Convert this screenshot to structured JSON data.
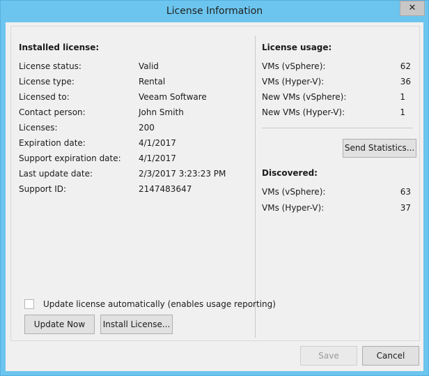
{
  "window": {
    "title": "License Information",
    "close_glyph": "✕"
  },
  "installed": {
    "heading": "Installed license:",
    "rows": [
      {
        "label": "License status:",
        "value": "Valid"
      },
      {
        "label": "License type:",
        "value": "Rental"
      },
      {
        "label": "Licensed to:",
        "value": "Veeam Software"
      },
      {
        "label": "Contact person:",
        "value": "John Smith"
      },
      {
        "label": "Licenses:",
        "value": "200"
      },
      {
        "label": "Expiration date:",
        "value": "4/1/2017"
      },
      {
        "label": "Support expiration date:",
        "value": "4/1/2017"
      },
      {
        "label": "Last update date:",
        "value": "2/3/2017 3:23:23 PM"
      },
      {
        "label": "Support ID:",
        "value": "2147483647"
      }
    ]
  },
  "usage": {
    "heading": "License usage:",
    "rows": [
      {
        "label": "VMs (vSphere):",
        "value": "62"
      },
      {
        "label": "VMs (Hyper-V):",
        "value": "36"
      },
      {
        "label": "New VMs (vSphere):",
        "value": "1"
      },
      {
        "label": "New VMs (Hyper-V):",
        "value": "1"
      }
    ],
    "send_statistics_label": "Send Statistics..."
  },
  "discovered": {
    "heading": "Discovered:",
    "rows": [
      {
        "label": "VMs (vSphere):",
        "value": "63"
      },
      {
        "label": "VMs (Hyper-V):",
        "value": "37"
      }
    ]
  },
  "auto_update": {
    "label": "Update license automatically (enables usage reporting)",
    "checked": false
  },
  "buttons": {
    "update_now": "Update Now",
    "install_license": "Install License...",
    "save": "Save",
    "cancel": "Cancel"
  }
}
